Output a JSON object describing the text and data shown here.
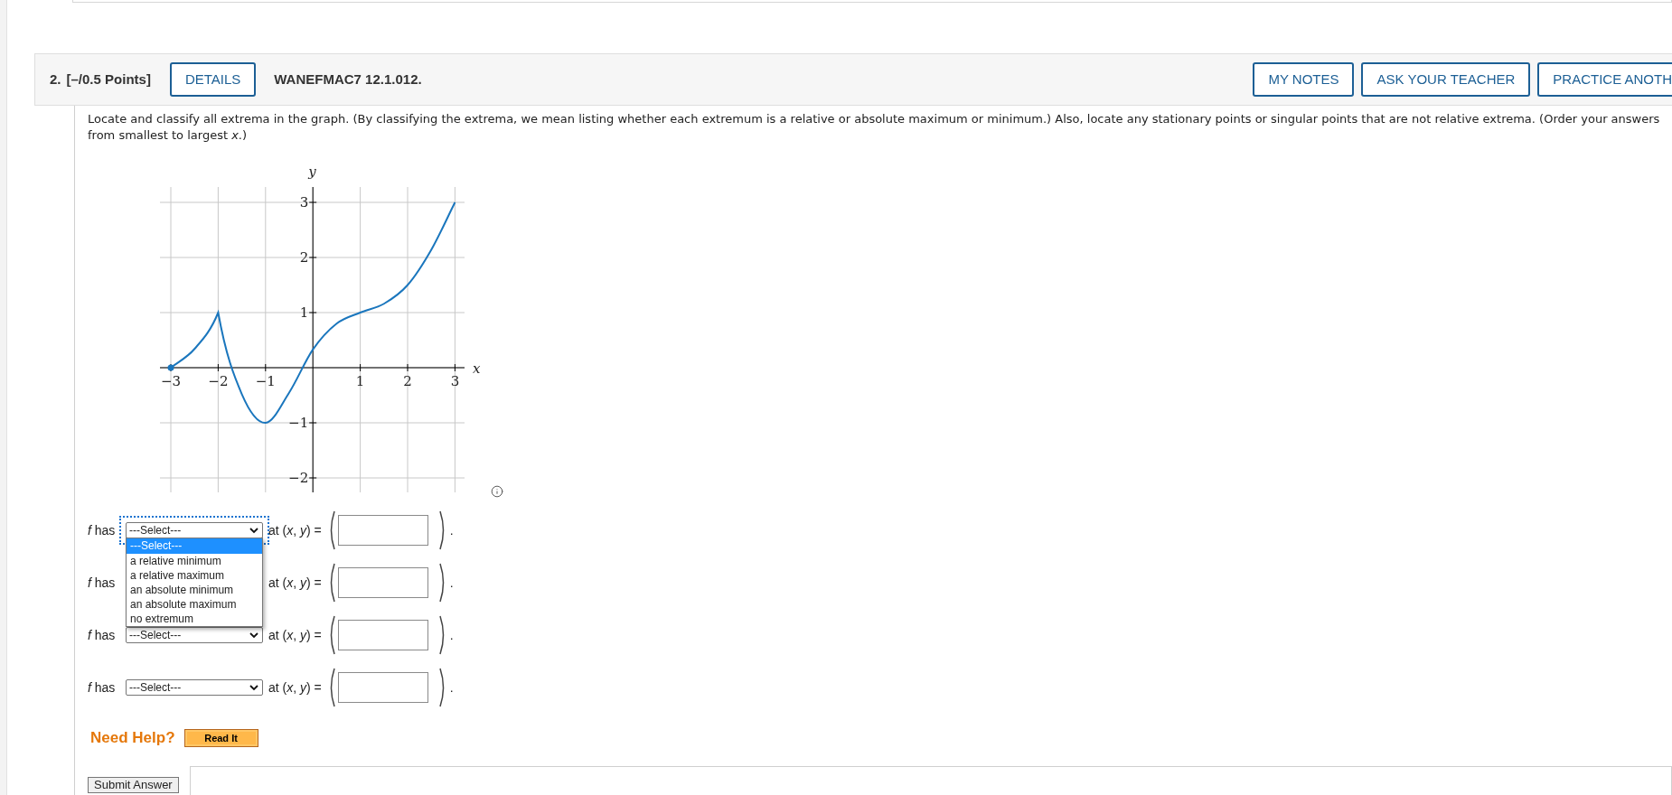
{
  "question": {
    "number": "2.",
    "points": "[–/0.5 Points]",
    "details_button": "DETAILS",
    "code": "WANEFMAC7 12.1.012.",
    "actions": [
      "MY NOTES",
      "ASK YOUR TEACHER",
      "PRACTICE ANOTH"
    ]
  },
  "prompt_lines": [
    "Locate and classify all extrema in the graph. (By classifying the extrema, we mean listing whether each extremum is a relative or absolute maximum or minimum.) Also, locate any stationary points or singular points that are not relative extrema. (Order your answers",
    "from smallest to largest *x*.)"
  ],
  "graph": {
    "chart_data": {
      "type": "line",
      "xlabel": "x",
      "ylabel": "y",
      "x": [
        -3,
        -2.5,
        -2,
        -1.5,
        -1,
        -0.5,
        0,
        0.5,
        1,
        1.5,
        2,
        2.5,
        3
      ],
      "grid": true,
      "series": [
        {
          "color": "#1a76bd",
          "values": [
            0,
            0.34,
            1,
            -0.48,
            -1,
            -0.45,
            0.33,
            0.8,
            1,
            1.16,
            1.5,
            2.14,
            3
          ]
        }
      ],
      "xlim": [
        -3,
        3
      ],
      "ylim": [
        -2,
        3
      ],
      "xticks": [
        {
          "value": -3,
          "label": "−3"
        },
        {
          "value": -2,
          "label": "−2"
        },
        {
          "value": -1,
          "label": "−1"
        },
        {
          "value": 1,
          "label": "1"
        },
        {
          "value": 2,
          "label": "2"
        },
        {
          "value": 3,
          "label": "3"
        }
      ],
      "yticks": [
        {
          "value": -2,
          "label": "−2"
        },
        {
          "value": -1,
          "label": "−1"
        },
        {
          "value": 1,
          "label": "1"
        },
        {
          "value": 2,
          "label": "2"
        },
        {
          "value": 3,
          "label": "3"
        }
      ]
    }
  },
  "rows": [
    {
      "lead": "*f* has",
      "select": "---Select---",
      "open": true,
      "after": "at (*x*, *y*) =",
      "end": "."
    },
    {
      "lead": "*f* has",
      "open": false,
      "after": "at (*x*, *y*) =",
      "end": "."
    },
    {
      "lead": "*f* has",
      "select": "---Select---",
      "open": false,
      "after": "at (*x*, *y*) =",
      "end": "."
    },
    {
      "lead": "*f* has",
      "select": "---Select---",
      "open": false,
      "after": "at (*x*, *y*) =",
      "end": "."
    }
  ],
  "dropdown_options": [
    {
      "label": "---Select---",
      "selected": true
    },
    {
      "label": "a relative minimum",
      "selected": false
    },
    {
      "label": "a relative maximum",
      "selected": false
    },
    {
      "label": "an absolute minimum",
      "selected": false
    },
    {
      "label": "an absolute maximum",
      "selected": false
    },
    {
      "label": "no extremum",
      "selected": false
    }
  ],
  "help": {
    "label": "Need Help?",
    "button": "Read It"
  },
  "submit": "Submit Answer"
}
